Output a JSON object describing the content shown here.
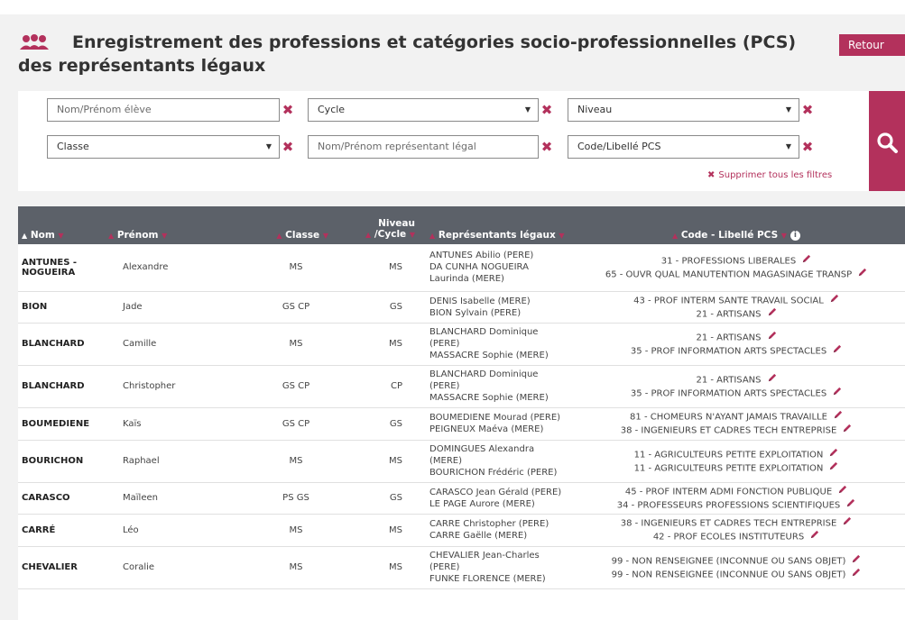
{
  "page": {
    "title": "Enregistrement des professions et catégories socio-professionnelles (PCS) des représentants légaux",
    "retour_label": "Retour",
    "title_icon": "users-icon",
    "accent_color": "#b3315c"
  },
  "filters": {
    "nom_eleve_placeholder": "Nom/Prénom élève",
    "cycle_value": "Cycle",
    "niveau_value": "Niveau",
    "classe_value": "Classe",
    "nom_representant_placeholder": "Nom/Prénom représentant légal",
    "code_pcs_value": "Code/Libellé PCS",
    "clear_all_label": "Supprimer tous les filtres",
    "search_icon": "search-icon",
    "clear_icon": "close-icon"
  },
  "table": {
    "headers": {
      "nom": "Nom",
      "prenom": "Prénom",
      "classe": "Classe",
      "niveau_1": "Niveau",
      "niveau_2": "/Cycle",
      "representants": "Représentants légaux",
      "pcs": "Code - Libellé PCS"
    },
    "rows": [
      {
        "nom": "ANTUNES - NOGUEIRA",
        "prenom": "Alexandre",
        "classe": "MS",
        "niveau": "MS",
        "representants": [
          "ANTUNES Abilio (PERE)",
          "DA CUNHA NOGUEIRA",
          "Laurinda (MERE)"
        ],
        "pcs": [
          "31 - PROFESSIONS LIBERALES",
          "65 - OUVR QUAL MANUTENTION MAGASINAGE TRANSP"
        ]
      },
      {
        "nom": "BION",
        "prenom": "Jade",
        "classe": "GS CP",
        "niveau": "GS",
        "representants": [
          "DENIS Isabelle (MERE)",
          "BION Sylvain (PERE)"
        ],
        "pcs": [
          "43 - PROF INTERM SANTE TRAVAIL SOCIAL",
          "21 - ARTISANS"
        ]
      },
      {
        "nom": "BLANCHARD",
        "prenom": "Camille",
        "classe": "MS",
        "niveau": "MS",
        "representants": [
          "BLANCHARD Dominique",
          "(PERE)",
          "MASSACRE Sophie (MERE)"
        ],
        "pcs": [
          "21 - ARTISANS",
          "35 - PROF INFORMATION ARTS SPECTACLES"
        ]
      },
      {
        "nom": "BLANCHARD",
        "prenom": "Christopher",
        "classe": "GS CP",
        "niveau": "CP",
        "representants": [
          "BLANCHARD Dominique",
          "(PERE)",
          "MASSACRE Sophie (MERE)"
        ],
        "pcs": [
          "21 - ARTISANS",
          "35 - PROF INFORMATION ARTS SPECTACLES"
        ]
      },
      {
        "nom": "BOUMEDIENE",
        "prenom": "Kaïs",
        "classe": "GS CP",
        "niveau": "GS",
        "representants": [
          "BOUMEDIENE Mourad (PERE)",
          "PEIGNEUX Maéva (MERE)"
        ],
        "pcs": [
          "81 - CHOMEURS N'AYANT JAMAIS TRAVAILLE",
          "38 - INGENIEURS ET CADRES TECH ENTREPRISE"
        ]
      },
      {
        "nom": "BOURICHON",
        "prenom": "Raphael",
        "classe": "MS",
        "niveau": "MS",
        "representants": [
          "DOMINGUES Alexandra",
          "(MERE)",
          "BOURICHON Frédéric (PERE)"
        ],
        "pcs": [
          "11 - AGRICULTEURS PETITE EXPLOITATION",
          "11 - AGRICULTEURS PETITE EXPLOITATION"
        ]
      },
      {
        "nom": "CARASCO",
        "prenom": "Maïleen",
        "classe": "PS GS",
        "niveau": "GS",
        "representants": [
          "CARASCO Jean Gérald (PERE)",
          "LE PAGE Aurore (MERE)"
        ],
        "pcs": [
          "45 - PROF INTERM ADMI FONCTION PUBLIQUE",
          "34 - PROFESSEURS PROFESSIONS SCIENTIFIQUES"
        ]
      },
      {
        "nom": "CARRÉ",
        "prenom": "Léo",
        "classe": "MS",
        "niveau": "MS",
        "representants": [
          "CARRE Christopher (PERE)",
          "CARRE Gaëlle (MERE)"
        ],
        "pcs": [
          "38 - INGENIEURS ET CADRES TECH ENTREPRISE",
          "42 - PROF ECOLES INSTITUTEURS"
        ]
      },
      {
        "nom": "CHEVALIER",
        "prenom": "Coralie",
        "classe": "MS",
        "niveau": "MS",
        "representants": [
          "CHEVALIER Jean-Charles",
          "(PERE)",
          "FUNKE FLORENCE (MERE)"
        ],
        "pcs": [
          "99 - NON RENSEIGNEE (INCONNUE OU SANS OBJET)",
          "99 - NON RENSEIGNEE (INCONNUE OU SANS OBJET)"
        ]
      }
    ]
  }
}
